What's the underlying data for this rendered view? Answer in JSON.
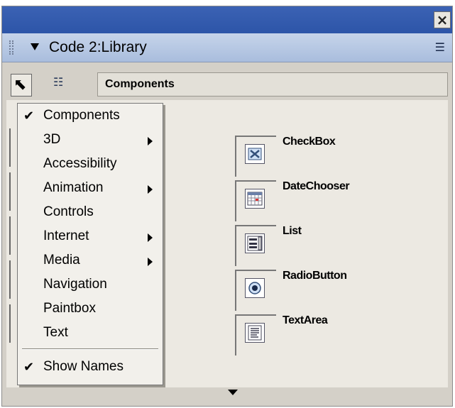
{
  "window": {
    "close_glyph": "×"
  },
  "panel": {
    "title": "Code 2:Library",
    "options_icon": "☰"
  },
  "toolbar": {
    "path_label": "Components"
  },
  "menu": {
    "items": [
      {
        "label": "Components",
        "checked": true,
        "submenu": false
      },
      {
        "label": "3D",
        "checked": false,
        "submenu": true
      },
      {
        "label": "Accessibility",
        "checked": false,
        "submenu": false
      },
      {
        "label": "Animation",
        "checked": false,
        "submenu": true
      },
      {
        "label": "Controls",
        "checked": false,
        "submenu": false
      },
      {
        "label": "Internet",
        "checked": false,
        "submenu": true
      },
      {
        "label": "Media",
        "checked": false,
        "submenu": true
      },
      {
        "label": "Navigation",
        "checked": false,
        "submenu": false
      },
      {
        "label": "Paintbox",
        "checked": false,
        "submenu": false
      },
      {
        "label": "Text",
        "checked": false,
        "submenu": false
      }
    ],
    "show_names": {
      "label": "Show Names",
      "checked": true
    },
    "check_glyph": "✔"
  },
  "components": [
    {
      "name": "CheckBox",
      "icon": "checkbox-icon"
    },
    {
      "name": "DateChooser",
      "icon": "date-chooser-icon"
    },
    {
      "name": "List",
      "icon": "list-icon"
    },
    {
      "name": "RadioButton",
      "icon": "radio-button-icon"
    },
    {
      "name": "TextArea",
      "icon": "text-area-icon"
    }
  ]
}
